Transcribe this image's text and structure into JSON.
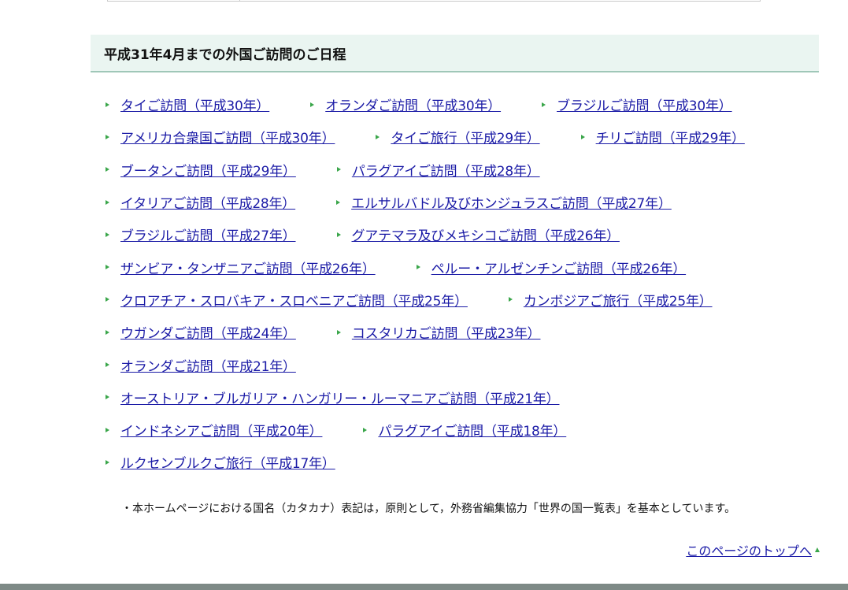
{
  "section": {
    "title": "平成31年4月までの外国ご訪問のご日程"
  },
  "links": {
    "rows": [
      [
        "タイご訪問（平成30年）",
        "オランダご訪問（平成30年）",
        "ブラジルご訪問（平成30年）"
      ],
      [
        "アメリカ合衆国ご訪問（平成30年）",
        "タイご旅行（平成29年）",
        "チリご訪問（平成29年）"
      ],
      [
        "ブータンご訪問（平成29年）",
        "パラグアイご訪問（平成28年）"
      ],
      [
        "イタリアご訪問（平成28年）",
        "エルサルバドル及びホンジュラスご訪問（平成27年）"
      ],
      [
        "ブラジルご訪問（平成27年）",
        "グアテマラ及びメキシコご訪問（平成26年）"
      ],
      [
        "ザンビア・タンザニアご訪問（平成26年）",
        "ペルー・アルゼンチンご訪問（平成26年）"
      ],
      [
        "クロアチア・スロバキア・スロベニアご訪問（平成25年）",
        "カンボジアご旅行（平成25年）"
      ],
      [
        "ウガンダご訪問（平成24年）",
        "コスタリカご訪問（平成23年）"
      ],
      [
        "オランダご訪問（平成21年）"
      ],
      [
        "オーストリア・ブルガリア・ハンガリー・ルーマニアご訪問（平成21年）"
      ],
      [
        "インドネシアご訪問（平成20年）",
        "パラグアイご訪問（平成18年）"
      ],
      [
        "ルクセンブルクご旅行（平成17年）"
      ]
    ]
  },
  "note": {
    "text": "・本ホームページにおける国名（カタカナ）表記は，原則として，外務省編集協力「世界の国一覧表」を基本としています。"
  },
  "page_top": {
    "label": "このページのトップへ"
  },
  "colors": {
    "link": "#1a1aa6",
    "arrow": "#3aa64a",
    "header_bg": "#eaf5f1",
    "header_border": "#9fc7b8",
    "footer_bar": "#7e8a86"
  }
}
